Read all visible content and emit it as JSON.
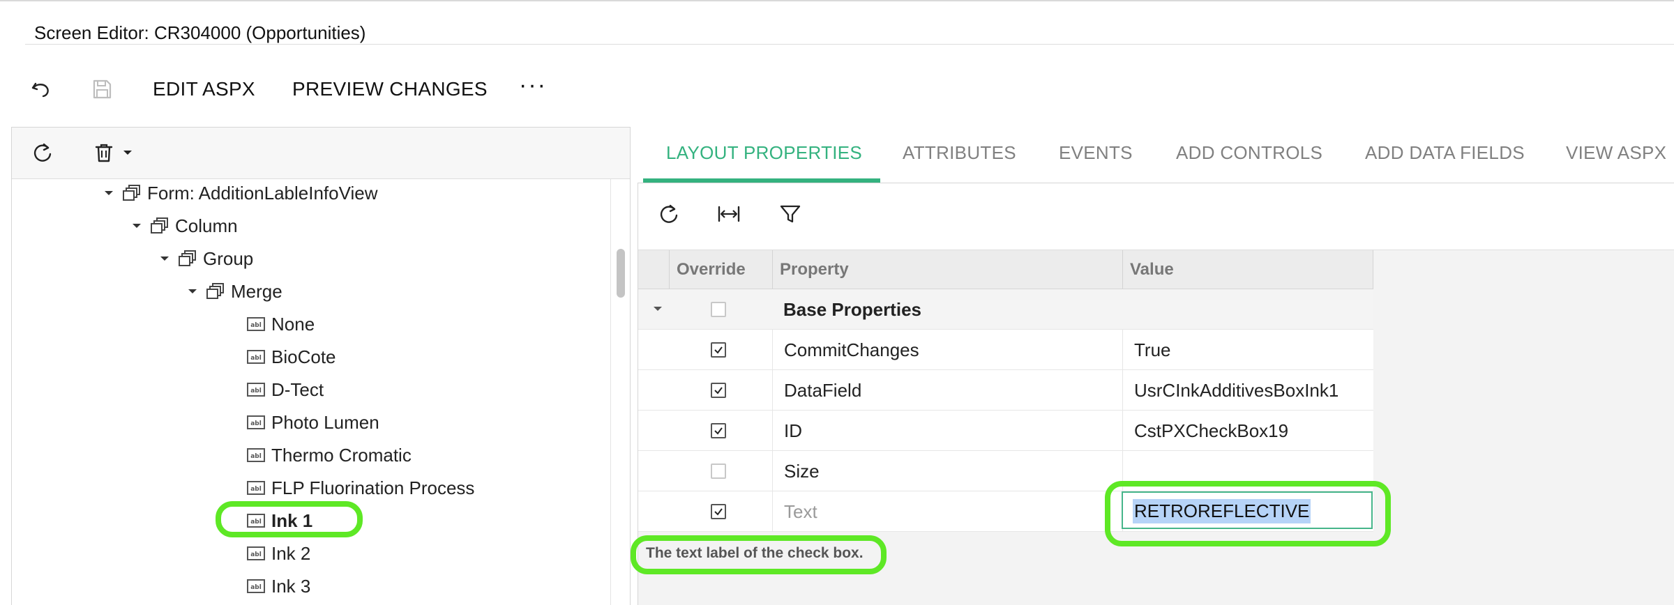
{
  "window": {
    "title": "Screen Editor: CR304000 (Opportunities)"
  },
  "toolbar": {
    "undo_icon": "undo-icon",
    "save_icon": "save-icon",
    "edit_aspx_label": "EDIT ASPX",
    "preview_changes_label": "PREVIEW CHANGES",
    "more_label": "···"
  },
  "tree": {
    "toolbar_icons": [
      "refresh-icon",
      "trash-icon",
      "caret-down-icon"
    ],
    "nodes": [
      {
        "label": "Form: AdditionLableInfoView",
        "type": "container",
        "expanded": true
      },
      {
        "label": "Column",
        "type": "container",
        "expanded": true
      },
      {
        "label": "Group",
        "type": "container",
        "expanded": true
      },
      {
        "label": "Merge",
        "type": "container",
        "expanded": true
      },
      {
        "label": "None",
        "type": "field"
      },
      {
        "label": "BioCote",
        "type": "field"
      },
      {
        "label": "D-Tect",
        "type": "field"
      },
      {
        "label": "Photo Lumen",
        "type": "field"
      },
      {
        "label": "Thermo Cromatic",
        "type": "field"
      },
      {
        "label": "FLP Fluorination Process",
        "type": "field"
      },
      {
        "label": "Ink 1",
        "type": "field",
        "selected": true
      },
      {
        "label": "Ink 2",
        "type": "field"
      },
      {
        "label": "Ink 3",
        "type": "field"
      }
    ]
  },
  "tabs": [
    {
      "label": "LAYOUT PROPERTIES",
      "active": true
    },
    {
      "label": "ATTRIBUTES"
    },
    {
      "label": "EVENTS"
    },
    {
      "label": "ADD CONTROLS"
    },
    {
      "label": "ADD DATA FIELDS"
    },
    {
      "label": "VIEW ASPX"
    }
  ],
  "properties_toolbar": {
    "icons": [
      "refresh-icon",
      "fit-width-icon",
      "filter-icon"
    ]
  },
  "grid": {
    "columns": [
      "Override",
      "Property",
      "Value"
    ],
    "group": {
      "label": "Base Properties",
      "override": false
    },
    "rows": [
      {
        "override": true,
        "property": "CommitChanges",
        "value": "True"
      },
      {
        "override": true,
        "property": "DataField",
        "value": "UsrCInkAdditivesBoxInk1"
      },
      {
        "override": true,
        "property": "ID",
        "value": "CstPXCheckBox19"
      },
      {
        "override": false,
        "property": "Size",
        "value": ""
      },
      {
        "override": true,
        "property": "Text",
        "value": "RETROREFLECTIVE",
        "editing": true
      }
    ]
  },
  "hint": "The text label of the check box.",
  "colors": {
    "accent": "#34b27f",
    "highlight": "#5ee825",
    "selection": "#b6d3f7"
  }
}
